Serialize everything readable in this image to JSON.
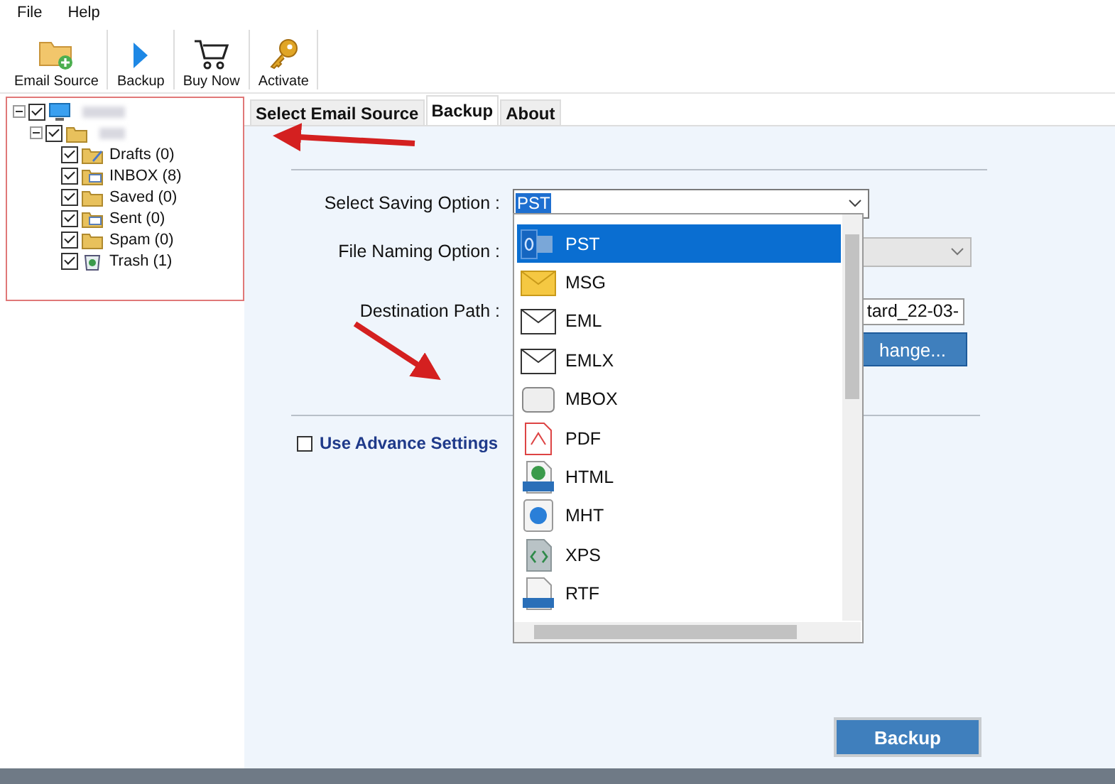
{
  "menu": [
    "File",
    "Help"
  ],
  "toolbar": [
    {
      "label": "Email Source",
      "kind": "folder-add"
    },
    {
      "label": "Backup",
      "kind": "play"
    },
    {
      "label": "Buy Now",
      "kind": "cart"
    },
    {
      "label": "Activate",
      "kind": "key"
    }
  ],
  "tree": {
    "checked": true,
    "expanded": true,
    "children": [
      {
        "checked": true,
        "expanded": true,
        "children": [
          {
            "label": "Drafts (0)",
            "checked": true,
            "kind": "drafts"
          },
          {
            "label": "INBOX (8)",
            "checked": true,
            "kind": "inbox"
          },
          {
            "label": "Saved (0)",
            "checked": true,
            "kind": "folder"
          },
          {
            "label": "Sent (0)",
            "checked": true,
            "kind": "sent"
          },
          {
            "label": "Spam (0)",
            "checked": true,
            "kind": "folder"
          },
          {
            "label": "Trash (1)",
            "checked": true,
            "kind": "trash"
          }
        ]
      }
    ]
  },
  "tabs": [
    {
      "label": "Select Email Source",
      "selected": false
    },
    {
      "label": "Backup",
      "selected": true
    },
    {
      "label": "About",
      "selected": false
    }
  ],
  "form": {
    "saving_label": "Select Saving Option :",
    "saving_value": "PST",
    "naming_label": "File Naming Option :",
    "destination_label": "Destination Path :",
    "destination_value": "tard_22-03-",
    "change_button": "hange...",
    "advanced": {
      "label": "Use Advance Settings",
      "checked": false
    }
  },
  "dropdown": {
    "items": [
      {
        "label": "PST",
        "selected": true,
        "kind": "pst"
      },
      {
        "label": "MSG",
        "selected": false,
        "kind": "msg"
      },
      {
        "label": "EML",
        "selected": false,
        "kind": "eml"
      },
      {
        "label": "EMLX",
        "selected": false,
        "kind": "eml"
      },
      {
        "label": "MBOX",
        "selected": false,
        "kind": "mbox"
      },
      {
        "label": "PDF",
        "selected": false,
        "kind": "pdf"
      },
      {
        "label": "HTML",
        "selected": false,
        "kind": "html"
      },
      {
        "label": "MHT",
        "selected": false,
        "kind": "mht"
      },
      {
        "label": "XPS",
        "selected": false,
        "kind": "xps"
      },
      {
        "label": "RTF",
        "selected": false,
        "kind": "rtf"
      }
    ]
  },
  "backup_button": "Backup"
}
